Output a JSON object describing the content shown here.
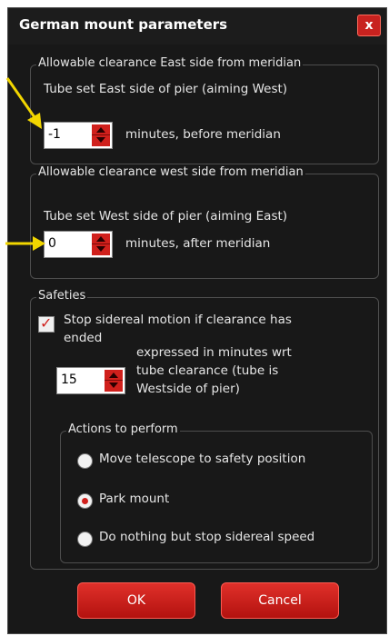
{
  "dialog": {
    "title": "German mount parameters",
    "close_glyph": "x"
  },
  "east": {
    "legend": "Allowable clearance East side from meridian",
    "desc": "Tube set East side of pier (aiming West)",
    "value": "-1",
    "suffix": "minutes, before meridian"
  },
  "west": {
    "legend": "Allowable clearance west side from meridian",
    "desc": "Tube set West side of pier (aiming East)",
    "value": "0",
    "suffix": "minutes, after meridian"
  },
  "safeties": {
    "legend": "Safeties",
    "stop_line1": "Stop sidereal motion if clearance has",
    "stop_line2": "ended",
    "stop_checked": true,
    "minutes_value": "15",
    "expr_line1": "expressed in minutes wrt",
    "expr_line2": "tube clearance (tube is",
    "expr_line3": "Westside of pier)",
    "actions": {
      "legend": "Actions to perform",
      "options": [
        {
          "label": "Move telescope to safety position",
          "selected": false
        },
        {
          "label": "Park mount",
          "selected": true
        },
        {
          "label": "Do nothing but stop sidereal speed",
          "selected": false
        }
      ]
    }
  },
  "buttons": {
    "ok": "OK",
    "cancel": "Cancel"
  },
  "colors": {
    "accent": "#d0201c",
    "background": "#181818",
    "annotation_arrow": "#f2d600"
  },
  "icons": {
    "annotation": "arrow-pointer-icon",
    "spin": "spin-arrows-icon"
  }
}
